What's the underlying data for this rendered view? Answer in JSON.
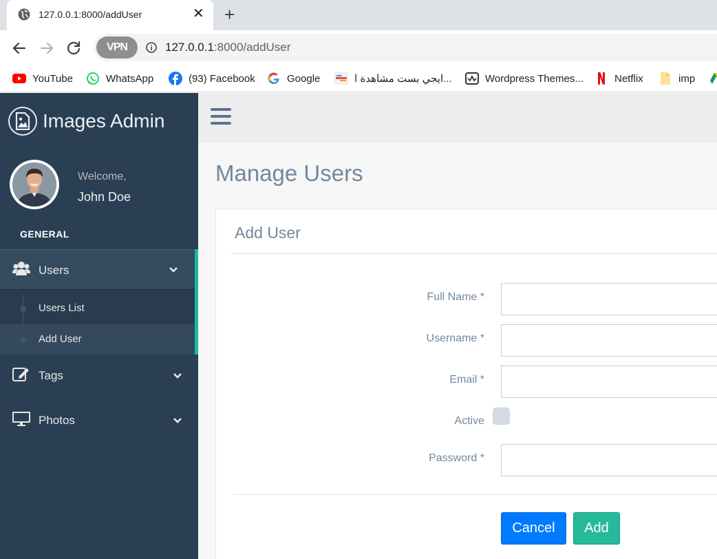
{
  "browser": {
    "tab_title": "127.0.0.1:8000/addUser",
    "url_host": "127.0.0.1",
    "url_rest": ":8000/addUser",
    "vpn_label": "VPN",
    "bookmarks": [
      {
        "label": "YouTube",
        "icon": "youtube-icon"
      },
      {
        "label": "WhatsApp",
        "icon": "whatsapp-icon"
      },
      {
        "label": "(93) Facebook",
        "icon": "facebook-icon"
      },
      {
        "label": "Google",
        "icon": "google-icon"
      },
      {
        "label": "ايجي بست مشاهدة ا...",
        "icon": "egybest-icon"
      },
      {
        "label": "Wordpress Themes...",
        "icon": "wordpress-themes-icon"
      },
      {
        "label": "Netflix",
        "icon": "netflix-icon"
      },
      {
        "label": "imp",
        "icon": "folder-icon"
      }
    ]
  },
  "sidebar": {
    "brand": "Images Admin",
    "welcome": "Welcome,",
    "user_name": "John Doe",
    "section": "GENERAL",
    "menu": {
      "users": "Users",
      "users_sub": [
        "Users List",
        "Add User"
      ],
      "tags": "Tags",
      "photos": "Photos"
    }
  },
  "main": {
    "page_title": "Manage Users",
    "panel_title": "Add User",
    "form": {
      "full_name_label": "Full Name *",
      "username_label": "Username *",
      "email_label": "Email *",
      "active_label": "Active",
      "password_label": "Password *"
    },
    "buttons": {
      "cancel": "Cancel",
      "add": "Add"
    }
  },
  "colors": {
    "sidebar_bg": "#2a3f54",
    "accent_green": "#1abb9c",
    "cancel_blue": "#007bff",
    "add_green": "#26b99a",
    "text_muted": "#73879c"
  }
}
